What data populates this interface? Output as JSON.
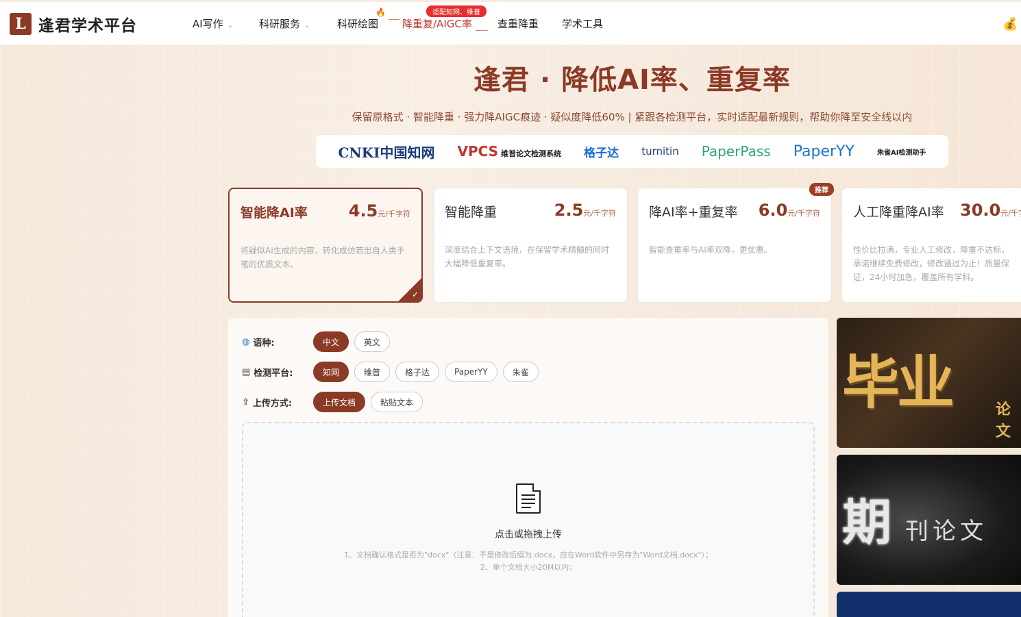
{
  "brand": {
    "logo_char": "L",
    "name": "逢君学术平台"
  },
  "nav": {
    "items": [
      {
        "label": "AI写作",
        "dropdown": true
      },
      {
        "label": "科研服务",
        "dropdown": true
      },
      {
        "label": "科研绘图"
      },
      {
        "label": "降重复/AIGC率",
        "badge": "适配知网、维普"
      },
      {
        "label": "查重降重"
      },
      {
        "label": "学术工具"
      }
    ],
    "chevron": "⌄",
    "hot_icon": "🔥",
    "coin_icon": "💰"
  },
  "hero": {
    "title": "逢君 · 降低AI率、重复率",
    "subtitle": "保留原格式 · 智能降重 · 强力降AIGC痕迹 · 疑似度降低60%  |  紧跟各检测平台，实时适配最新规则，帮助你降至安全线以内"
  },
  "platforms": {
    "cnki": "CNKI中国知网",
    "vpcs": "VPCS",
    "vpcs_cn": "维普论文检测系统",
    "gezida": "格子达",
    "turnitin": "turnitin",
    "paperpass": "PaperPass",
    "paperyy": "PaperYY",
    "zhuque": "朱雀AI检测助手"
  },
  "cards": [
    {
      "name": "智能降AI率",
      "price": "4.5",
      "unit": "元/千字符",
      "desc": "将疑似AI生成的内容，转化成仿若出自人类手笔的优质文本。",
      "selected": true
    },
    {
      "name": "智能降重",
      "price": "2.5",
      "unit": "元/千字符",
      "desc": "深度结合上下文语境，在保留学术精髓的同时大幅降低重复率。"
    },
    {
      "name": "降AI率+重复率",
      "price": "6.0",
      "unit": "元/千字符",
      "desc": "智能查重率与AI率双降，更优惠。",
      "badge": "推荐"
    },
    {
      "name": "人工降重降AI率",
      "price": "30.0",
      "unit": "元/千字符",
      "desc": "性价比拉满，专业人工修改，降重不达标，承诺继续免费修改，修改通过为止！质量保证，24小时加急，覆盖所有学科。"
    }
  ],
  "check_mark": "✓",
  "form": {
    "language": {
      "label": "语种:",
      "icon": "globe-icon",
      "options": [
        "中文",
        "英文"
      ],
      "selected": "中文"
    },
    "platform": {
      "label": "检测平台:",
      "icon": "clipboard-icon",
      "options": [
        "知网",
        "维普",
        "格子达",
        "PaperYY",
        "朱雀"
      ],
      "selected": "知网"
    },
    "upload_mode": {
      "label": "上传方式:",
      "icon": "upload-icon",
      "options": [
        "上传文档",
        "粘贴文本"
      ],
      "selected": "上传文档"
    }
  },
  "upload": {
    "title": "点击或拖拽上传",
    "note_1": "1、文档确认格式是否为\"docx\"（注意：不是修改后缀为.docx，应在Word软件中另存为\"Word文档.docx\"）；",
    "note_2": "2、单个文档大小20M以内；"
  },
  "banners": {
    "b1_main": "毕业",
    "b1_side": "论文",
    "b2_main": "期",
    "b2_small": "刊论文"
  },
  "colors": {
    "brand": "#8b3a26",
    "badge_red": "#e82d2d",
    "page_bg": "#f7ece1"
  }
}
